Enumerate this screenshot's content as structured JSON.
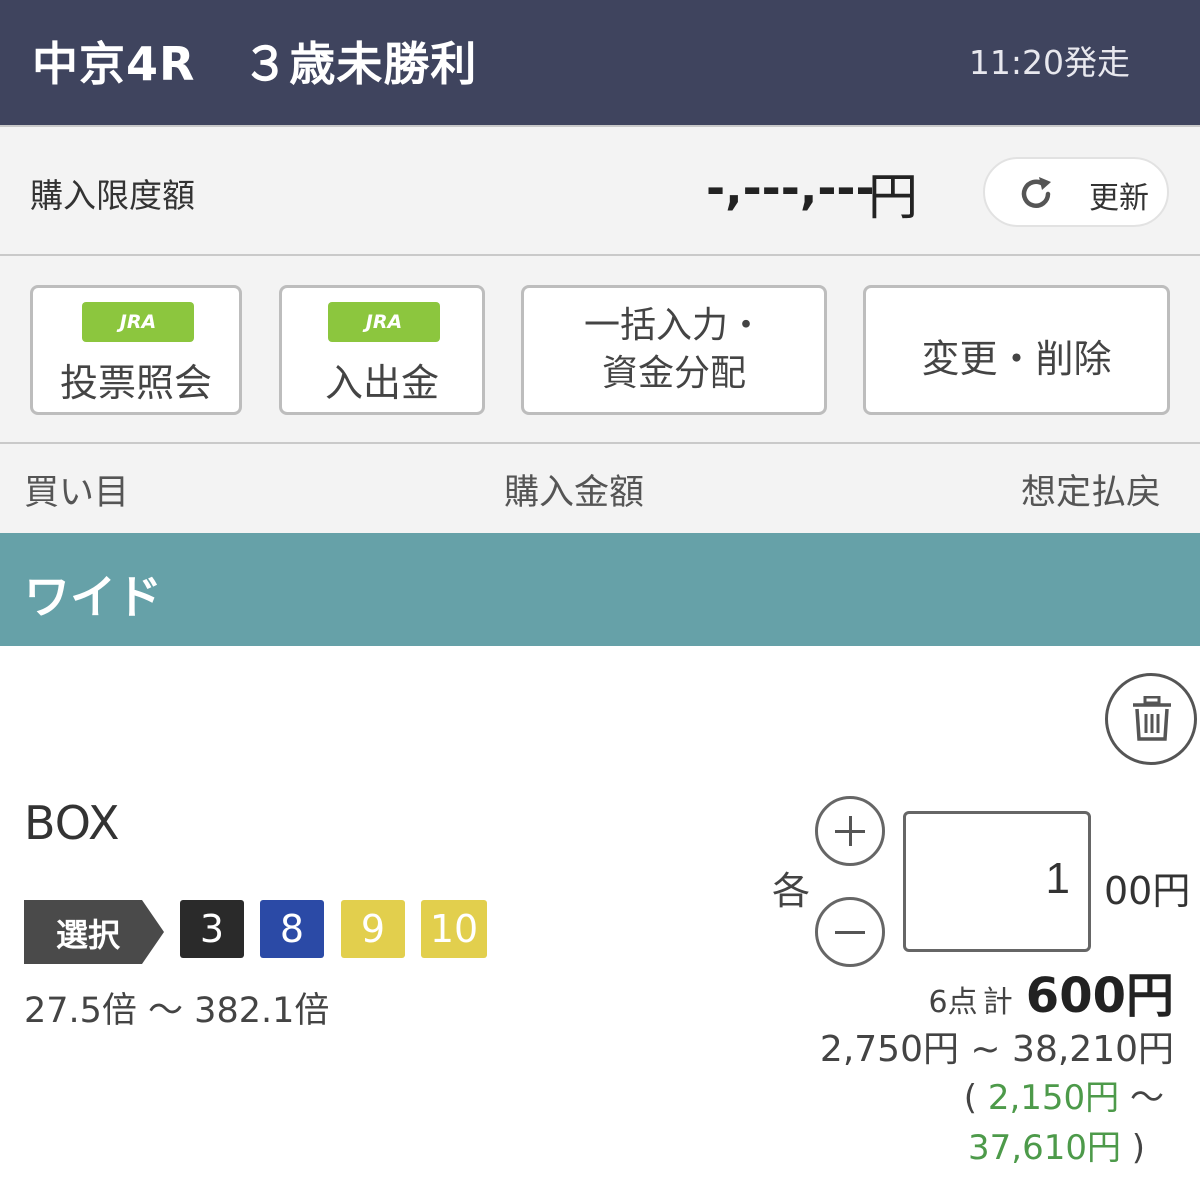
{
  "header": {
    "title": "中京4R　３歳未勝利",
    "post_time": "11:20発走"
  },
  "limit": {
    "label": "購入限度額",
    "amount": "-,---,---",
    "currency": "円",
    "refresh_label": "更新"
  },
  "actions": [
    {
      "badge": "JRA IPAT",
      "label": "投票照会"
    },
    {
      "badge": "JRA IPAT",
      "label": "入出金"
    },
    {
      "line1": "一括入力・",
      "line2": "資金分配"
    },
    {
      "label": "変更・削除"
    }
  ],
  "columns": {
    "selection": "買い目",
    "amount": "購入金額",
    "payout": "想定払戻"
  },
  "bet_type": "ワイド",
  "bet": {
    "method": "BOX",
    "select_label": "選択",
    "horses": [
      {
        "number": "3",
        "color": "#2a2a2a",
        "text_color": "#ffffff"
      },
      {
        "number": "8",
        "color": "#2b4aa6",
        "text_color": "#ffffff"
      },
      {
        "number": "9",
        "color": "#e2cf4d",
        "text_color": "#ffffff"
      },
      {
        "number": "10",
        "color": "#e2cf4d",
        "text_color": "#ffffff"
      }
    ],
    "odds_range": "27.5倍 ～ 382.1倍",
    "each_label": "各",
    "amount_value": "1",
    "amount_unit": "00円",
    "points": "6点",
    "total_label": "計",
    "total": "600円",
    "payout_range": "2,750円 ~ 38,210円",
    "refund_open": "(",
    "refund_min": "2,150円",
    "refund_tilde": "～",
    "refund_max": "37,610円",
    "refund_close": ")"
  },
  "colors": {
    "header_bg": "#3f445e",
    "section_bg": "#66a1a8",
    "ipat_green": "#8cc63e",
    "refund_green": "#4d9a4a"
  }
}
